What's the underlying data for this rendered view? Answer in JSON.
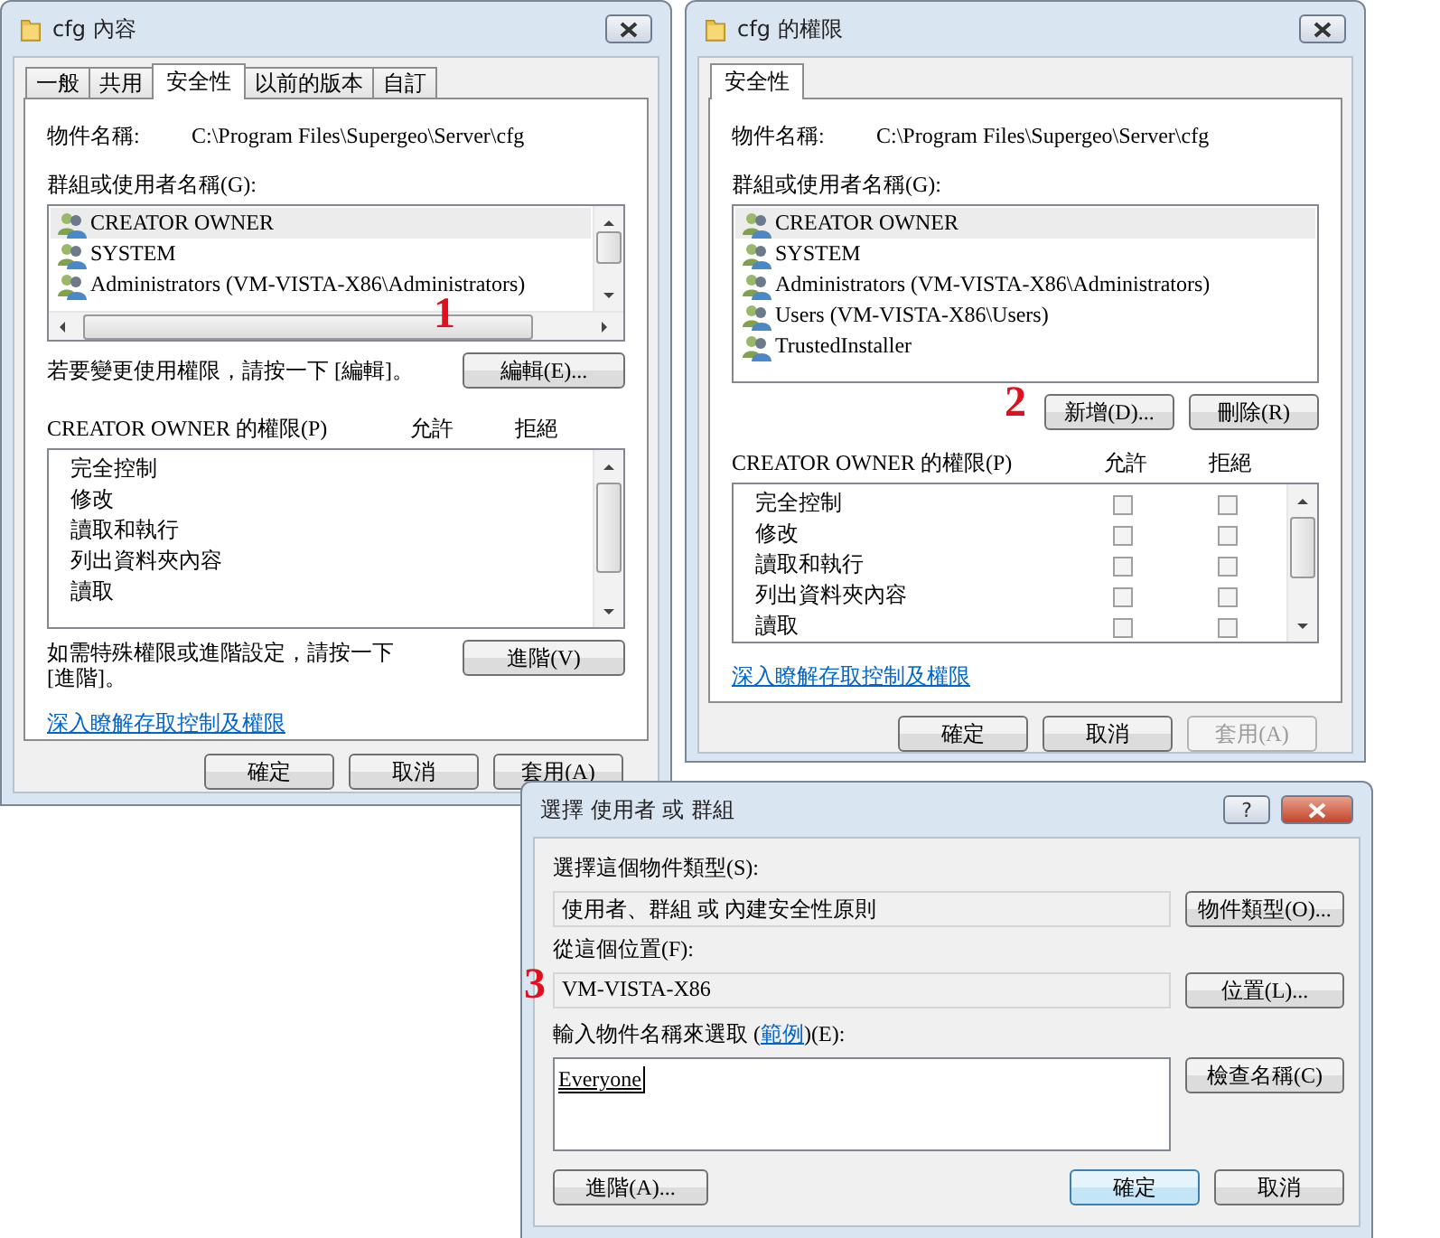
{
  "properties_window": {
    "title": "cfg 內容",
    "tabs": [
      {
        "label": "一般",
        "selected": false
      },
      {
        "label": "共用",
        "selected": false
      },
      {
        "label": "安全性",
        "selected": true
      },
      {
        "label": "以前的版本",
        "selected": false
      },
      {
        "label": "自訂",
        "selected": false
      }
    ],
    "object_name_label": "物件名稱:",
    "object_name": "C:\\Program Files\\Supergeo\\Server\\cfg",
    "groups_label": "群組或使用者名稱(G):",
    "groups": [
      {
        "name": "CREATOR OWNER",
        "selected": true
      },
      {
        "name": "SYSTEM",
        "selected": false
      },
      {
        "name": "Administrators (VM-VISTA-X86\\Administrators)",
        "selected": false
      }
    ],
    "edit_hint": "若要變更使用權限，請按一下 [編輯]。",
    "edit_button": "編輯(E)...",
    "permissions_label": "CREATOR OWNER 的權限(P)",
    "allow_label": "允許",
    "deny_label": "拒絕",
    "permissions": [
      {
        "name": "完全控制"
      },
      {
        "name": "修改"
      },
      {
        "name": "讀取和執行"
      },
      {
        "name": "列出資料夾內容"
      },
      {
        "name": "讀取"
      }
    ],
    "advanced_hint": "如需特殊權限或進階設定，請按一下 [進階]。",
    "advanced_button": "進階(V)",
    "link": "深入瞭解存取控制及權限",
    "buttons": [
      {
        "label": "確定",
        "disabled": false
      },
      {
        "label": "取消",
        "disabled": false
      },
      {
        "label": "套用(A)",
        "disabled": false
      }
    ]
  },
  "permissions_window": {
    "title": "cfg 的權限",
    "tabs": [
      {
        "label": "安全性",
        "selected": true
      }
    ],
    "object_name_label": "物件名稱:",
    "object_name": "C:\\Program Files\\Supergeo\\Server\\cfg",
    "groups_label": "群組或使用者名稱(G):",
    "groups": [
      {
        "name": "CREATOR OWNER",
        "selected": true
      },
      {
        "name": "SYSTEM",
        "selected": false
      },
      {
        "name": "Administrators (VM-VISTA-X86\\Administrators)",
        "selected": false
      },
      {
        "name": "Users (VM-VISTA-X86\\Users)",
        "selected": false
      },
      {
        "name": "TrustedInstaller",
        "selected": false
      }
    ],
    "add_button": "新增(D)...",
    "remove_button": "刪除(R)",
    "permissions_label": "CREATOR OWNER 的權限(P)",
    "allow_label": "允許",
    "deny_label": "拒絕",
    "permissions": [
      {
        "name": "完全控制",
        "allow": false,
        "deny": false
      },
      {
        "name": "修改",
        "allow": false,
        "deny": false
      },
      {
        "name": "讀取和執行",
        "allow": false,
        "deny": false
      },
      {
        "name": "列出資料夾內容",
        "allow": false,
        "deny": false
      },
      {
        "name": "讀取",
        "allow": false,
        "deny": false
      }
    ],
    "link": "深入瞭解存取控制及權限",
    "buttons": [
      {
        "label": "確定",
        "disabled": false
      },
      {
        "label": "取消",
        "disabled": false
      },
      {
        "label": "套用(A)",
        "disabled": true
      }
    ]
  },
  "select_dialog": {
    "title": "選擇 使用者 或 群組",
    "help_button": "?",
    "object_type_label": "選擇這個物件類型(S):",
    "object_type": "使用者、群組 或 內建安全性原則",
    "object_type_button": "物件類型(O)...",
    "location_label": "從這個位置(F):",
    "location": "VM-VISTA-X86",
    "location_button": "位置(L)...",
    "names_label_before": "輸入物件名稱來選取 (",
    "names_link": "範例",
    "names_label_after": ")(E):",
    "names_value": "Everyone",
    "check_button": "檢查名稱(C)",
    "advanced_button": "進階(A)...",
    "buttons": [
      {
        "label": "確定",
        "default": true
      },
      {
        "label": "取消",
        "default": false
      }
    ]
  },
  "annotations": [
    {
      "text": "1"
    },
    {
      "text": "2"
    },
    {
      "text": "3"
    }
  ]
}
